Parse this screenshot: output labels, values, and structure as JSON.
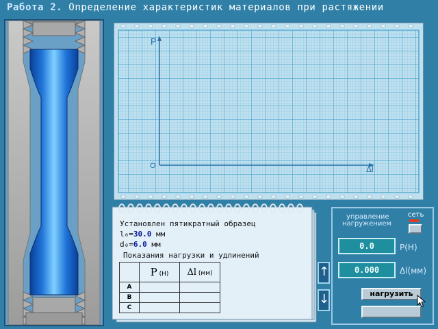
{
  "header": {
    "lab_label": "Работа 2.",
    "title": "Определение характеристик материалов при растяжении"
  },
  "graph": {
    "y_axis_label": "P",
    "x_axis_label": "Δl",
    "origin_label": "O"
  },
  "notebook": {
    "line1": "Установлен пятикратный образец",
    "l0_label": "l₀=",
    "l0_value": "30.0",
    "d0_label": "d₀=",
    "d0_value": "6.0",
    "unit_mm": "мм",
    "readings_title": "Показания нагрузки и удлинений",
    "table": {
      "col_p": "P",
      "col_p_unit": "(Н)",
      "col_dl": "Δl",
      "col_dl_unit": "(мм)",
      "rows": [
        "A",
        "B",
        "C"
      ]
    }
  },
  "scroll": {
    "up_icon": "↑",
    "down_icon": "↓"
  },
  "control": {
    "title_line1": "управление",
    "title_line2": "нагружением",
    "power_label": "сеть",
    "load_value": "0.0",
    "load_unit": "P(Н)",
    "elong_value": "0.000",
    "elong_unit": "Δl(мм)",
    "load_button": "нагрузить"
  },
  "colors": {
    "background": "#2f7fa6",
    "graph_paper": "#bfe0ef",
    "lcd": "#1f8f9f",
    "power_indicator": "#e23a1e",
    "specimen": "#1e6fd0"
  }
}
